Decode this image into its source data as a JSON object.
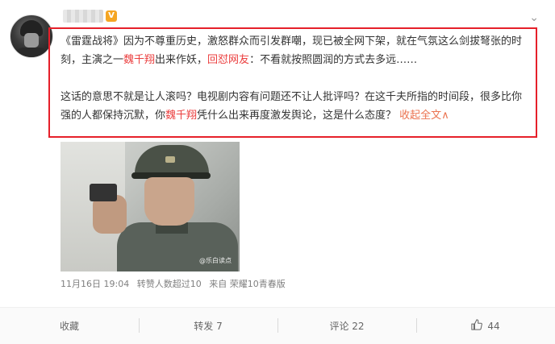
{
  "post": {
    "vip_badge": "V",
    "paragraph1": [
      {
        "text": "《雷霆战将》因为不尊重历史，激怒群众而引发群嘲，现已被全网下架，就在气氛这么剑拔弩张的时刻，主演之一",
        "style": "normal"
      },
      {
        "text": "魏千翔",
        "style": "hl"
      },
      {
        "text": "出来作妖，",
        "style": "normal"
      },
      {
        "text": "回怼网友",
        "style": "hl"
      },
      {
        "text": "：不看就按照圆润的方式去多远……",
        "style": "normal"
      }
    ],
    "paragraph2": [
      {
        "text": "这话的意思不就是让人滚吗？电视剧内容有问题还不让人批评吗？在这千夫所指的时间段，很多比你强的人都保持沉默，你",
        "style": "normal"
      },
      {
        "text": "魏千翔",
        "style": "hl"
      },
      {
        "text": "凭什么出来再度激发舆论，这是什么态度？",
        "style": "normal"
      }
    ],
    "collapse_label": "收起全文",
    "collapse_chevron": "∧",
    "watermark": "@乐白读点",
    "meta": {
      "time": "11月16日 19:04",
      "likes_note": "转赞人数超过10",
      "source": "来自 荣耀10青春版"
    }
  },
  "actions": {
    "favorite": "收藏",
    "repost": "转发 7",
    "comment": "评论 22",
    "like_count": "44"
  },
  "colors": {
    "highlight": "#eb3d3d",
    "link": "#eb7350",
    "box": "#e6202a"
  },
  "icons": {
    "more": "chevron-down-icon",
    "like": "thumb-up-icon"
  }
}
